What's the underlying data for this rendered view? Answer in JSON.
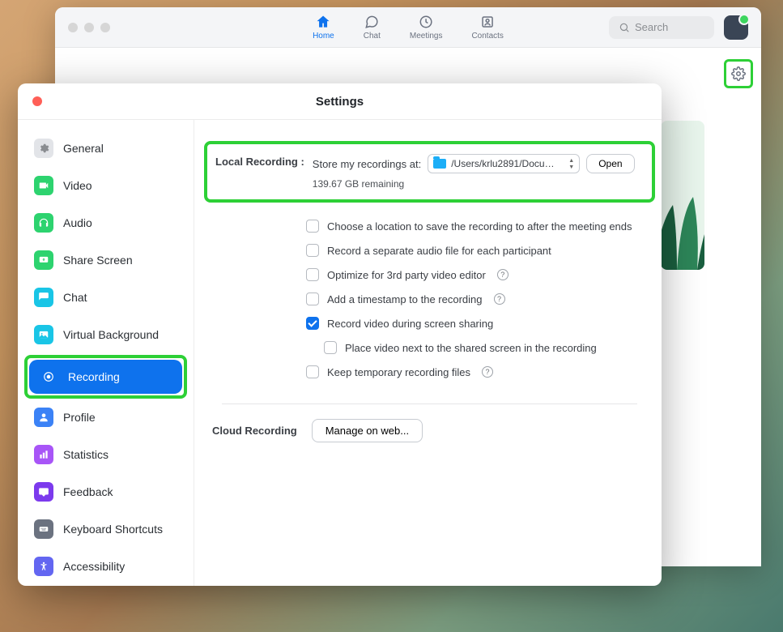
{
  "main_window": {
    "nav": {
      "home": "Home",
      "chat": "Chat",
      "meetings": "Meetings",
      "contacts": "Contacts"
    },
    "search_placeholder": "Search"
  },
  "settings": {
    "title": "Settings",
    "sidebar": [
      {
        "key": "general",
        "label": "General",
        "icon_bg": "#e2e4e8",
        "icon": "gear"
      },
      {
        "key": "video",
        "label": "Video",
        "icon_bg": "#2dd36f",
        "icon": "video"
      },
      {
        "key": "audio",
        "label": "Audio",
        "icon_bg": "#2dd36f",
        "icon": "headphones"
      },
      {
        "key": "share_screen",
        "label": "Share Screen",
        "icon_bg": "#2dd36f",
        "icon": "share"
      },
      {
        "key": "chat",
        "label": "Chat",
        "icon_bg": "#19c5e6",
        "icon": "chat"
      },
      {
        "key": "virtual_background",
        "label": "Virtual Background",
        "icon_bg": "#19c5e6",
        "icon": "image"
      },
      {
        "key": "recording",
        "label": "Recording",
        "icon_bg": "#ffffff",
        "icon": "record",
        "active": true
      },
      {
        "key": "profile",
        "label": "Profile",
        "icon_bg": "#3b82f6",
        "icon": "user"
      },
      {
        "key": "statistics",
        "label": "Statistics",
        "icon_bg": "#a855f7",
        "icon": "stats"
      },
      {
        "key": "feedback",
        "label": "Feedback",
        "icon_bg": "#7c3aed",
        "icon": "feedback"
      },
      {
        "key": "keyboard_shortcuts",
        "label": "Keyboard Shortcuts",
        "icon_bg": "#6b7280",
        "icon": "keyboard"
      },
      {
        "key": "accessibility",
        "label": "Accessibility",
        "icon_bg": "#6366f1",
        "icon": "accessibility"
      }
    ],
    "local_recording": {
      "heading": "Local Recording :",
      "store_label": "Store my recordings at:",
      "path": "/Users/krlu2891/Docum…",
      "open_button": "Open",
      "remaining": "139.67 GB remaining"
    },
    "options": [
      {
        "key": "choose_location",
        "label": "Choose a location to save the recording to after the meeting ends",
        "checked": false,
        "help": false
      },
      {
        "key": "separate_audio",
        "label": "Record a separate audio file for each participant",
        "checked": false,
        "help": false
      },
      {
        "key": "optimize_3rd_party",
        "label": "Optimize for 3rd party video editor",
        "checked": false,
        "help": true
      },
      {
        "key": "timestamp",
        "label": "Add a timestamp to the recording",
        "checked": false,
        "help": true
      },
      {
        "key": "record_video_screen",
        "label": "Record video during screen sharing",
        "checked": true,
        "help": false
      },
      {
        "key": "place_video_next",
        "label": "Place video next to the shared screen in the recording",
        "checked": false,
        "help": false,
        "indent": true
      },
      {
        "key": "keep_temp",
        "label": "Keep temporary recording files",
        "checked": false,
        "help": true
      }
    ],
    "cloud_recording": {
      "heading": "Cloud Recording",
      "button": "Manage on web..."
    }
  }
}
